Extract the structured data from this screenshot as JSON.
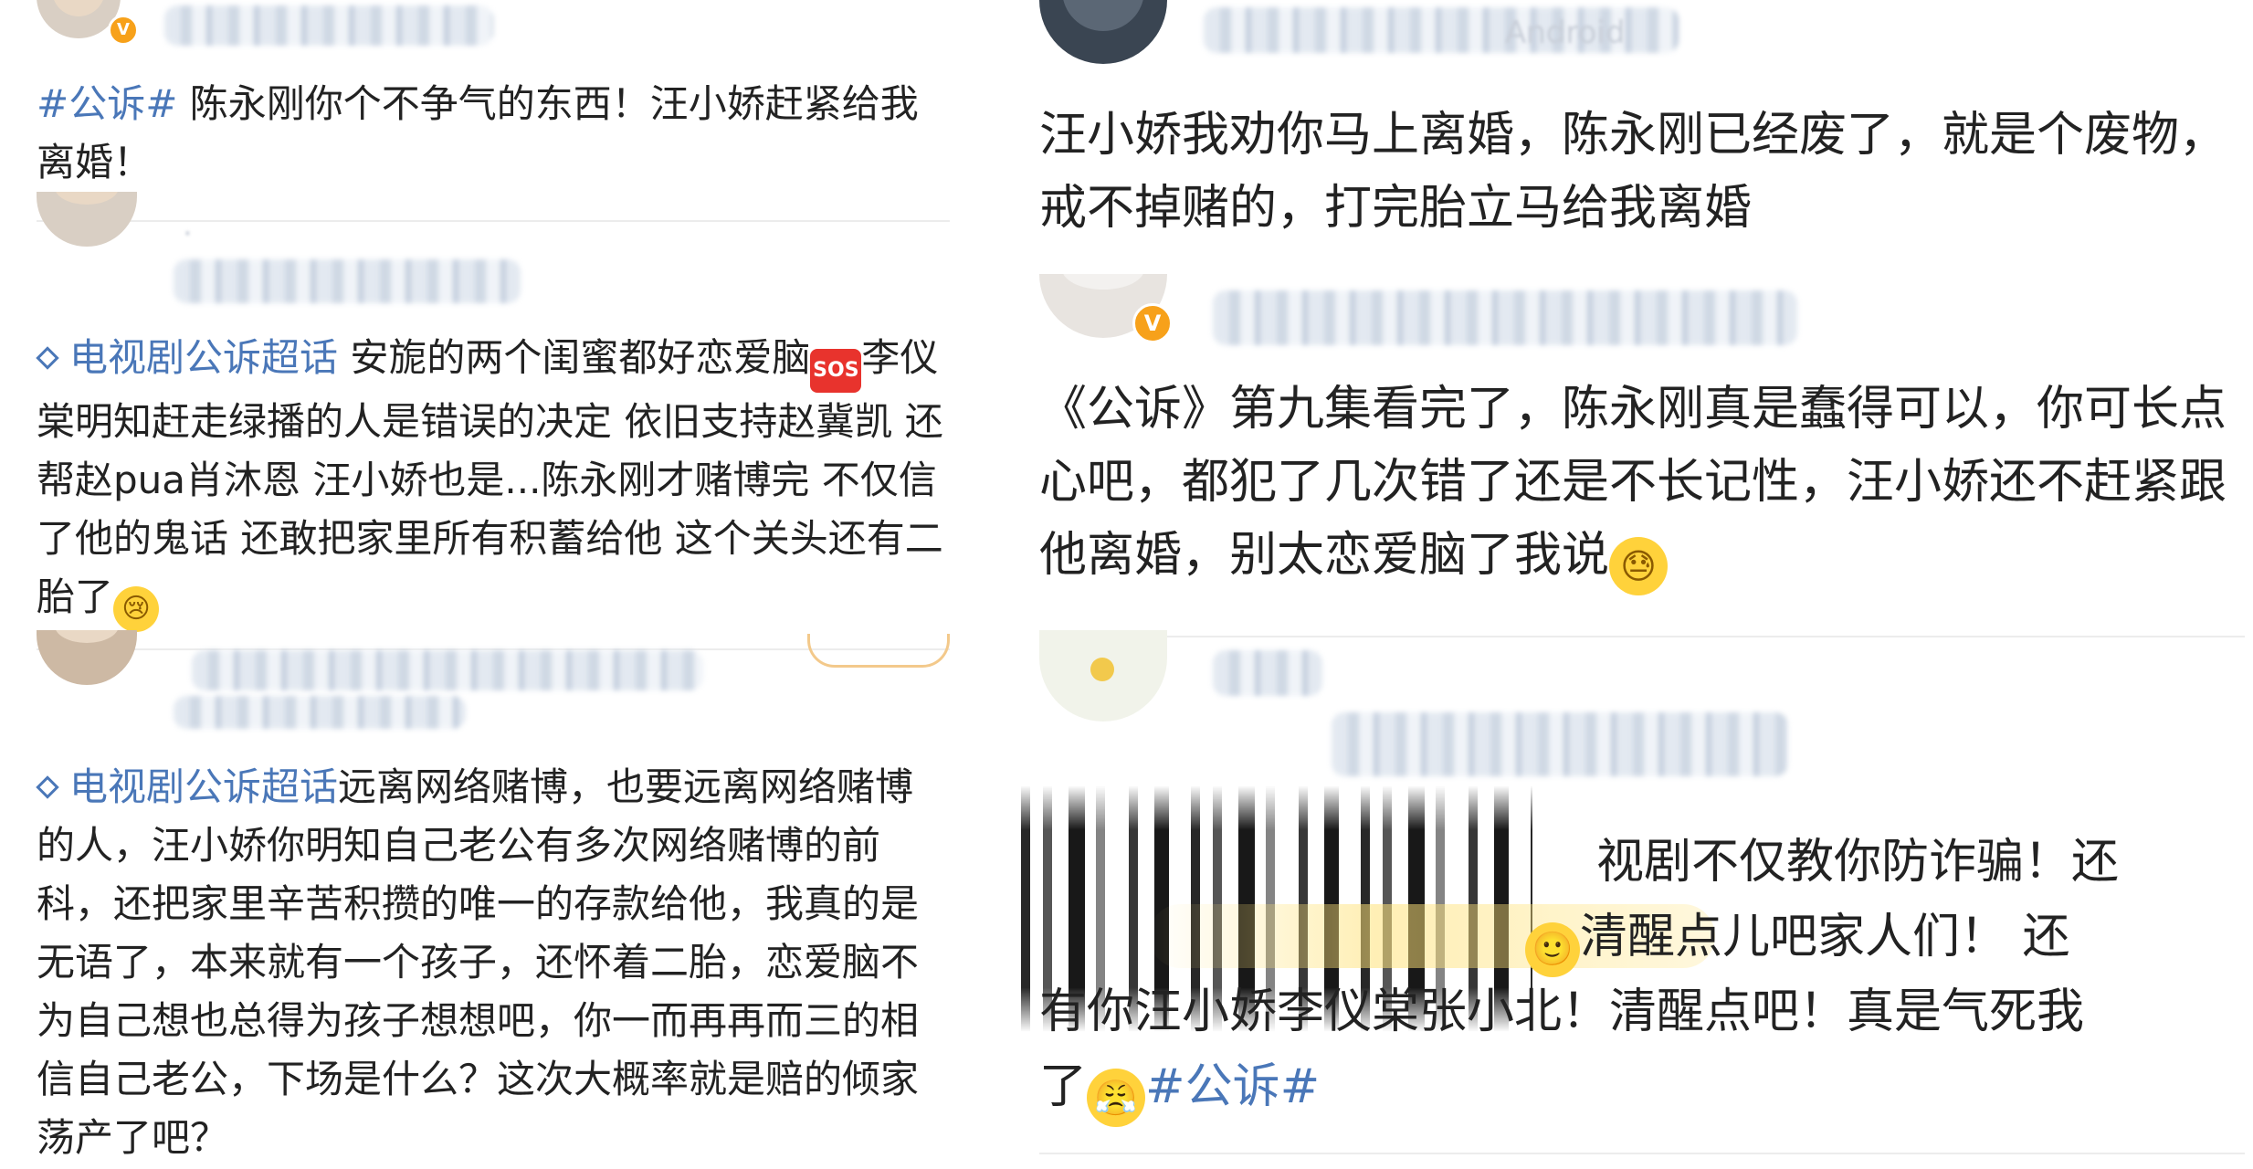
{
  "left": {
    "post1": {
      "tag": "#公诉#",
      "text": " 陈永刚你个不争气的东西！汪小娇赶紧给我离婚！"
    },
    "post2": {
      "supertopic": "电视剧公诉超话",
      "text_a": " 安旎的两个闺蜜都好恋爱脑",
      "sos": "SOS",
      "text_b": "李仪棠明知赶走绿播的人是错误的决定 依旧支持赵冀凯 还帮赵pua肖沐恩 汪小娇也是...陈永刚才赌博完 不仅信了他的鬼话 还敢把家里所有积蓄给他 这个关头还有二胎了",
      "emoji": "😢"
    },
    "post3": {
      "supertopic": "电视剧公诉超话",
      "text": "远离网络赌博，也要远离网络赌博的人，汪小娇你明知自己老公有多次网络赌博的前科，还把家里辛苦积攒的唯一的存款给他，我真的是无语了，本来就有一个孩子，还怀着二胎，恋爱脑不为自己想也总得为孩子想想吧，你一而再再而三的相信自己老公，下场是什么？这次大概率就是赔的倾家荡产了吧？"
    }
  },
  "right": {
    "post1": {
      "meta": "Android",
      "text": "汪小娇我劝你马上离婚，陈永刚已经废了，就是个废物，戒不掉赌的，打完胎立马给我离婚"
    },
    "post2": {
      "text": "《公诉》第九集看完了，陈永刚真是蠢得可以，你可长点心吧，都犯了几次错了还是不长记性，汪小娇还不赶紧跟他离婚，别太恋爱脑了我说",
      "emoji": "😓"
    },
    "post3": {
      "line1": "视剧不仅教你防诈骗！还",
      "emoji_smile": "🙂",
      "line2": "清醒点儿吧家人们！ 还",
      "line3": "有你汪小娇李仪棠张小北！清醒点吧！真是气死我",
      "line4": "了",
      "emoji_angry": "😤",
      "tag": "#公诉#"
    }
  },
  "colors": {
    "link": "#4a77b8",
    "verified": "#f7a11a",
    "divider": "#ececec"
  }
}
